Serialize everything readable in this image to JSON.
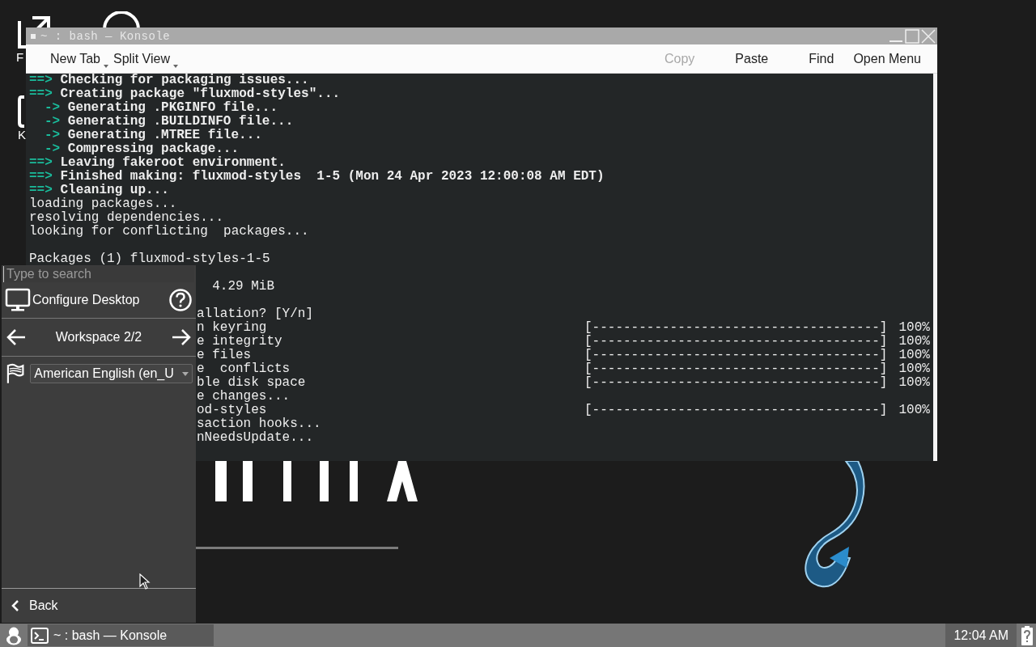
{
  "desktop": {
    "icons": [
      {
        "label": "F"
      },
      {
        "label": "K"
      }
    ]
  },
  "konsole": {
    "title": "~ : bash — Konsole",
    "toolbar": [
      {
        "label": "New Tab",
        "kind": "menu",
        "disabled": false
      },
      {
        "label": "Split View",
        "kind": "menu",
        "disabled": false
      },
      {
        "label": "Copy",
        "kind": "action",
        "disabled": true
      },
      {
        "label": "Paste",
        "kind": "action",
        "disabled": false
      },
      {
        "label": "Find",
        "kind": "action",
        "disabled": false
      },
      {
        "label": "Open Menu",
        "kind": "action",
        "disabled": false
      }
    ],
    "lines": [
      {
        "kind": "step",
        "marker": "==>",
        "text": "Checking for packaging issues..."
      },
      {
        "kind": "step",
        "marker": "==>",
        "text": "Creating package \"fluxmod-styles\"..."
      },
      {
        "kind": "substep",
        "marker": "->",
        "text": "Generating .PKGINFO file..."
      },
      {
        "kind": "substep",
        "marker": "->",
        "text": "Generating .BUILDINFO file..."
      },
      {
        "kind": "substep",
        "marker": "->",
        "text": "Generating .MTREE file..."
      },
      {
        "kind": "substep",
        "marker": "->",
        "text": "Compressing package..."
      },
      {
        "kind": "step",
        "marker": "==>",
        "text": "Leaving fakeroot environment."
      },
      {
        "kind": "step",
        "marker": "==>",
        "text": "Finished making: fluxmod-styles  1-5 (Mon 24 Apr 2023 12:00:08 AM EDT)"
      },
      {
        "kind": "step",
        "marker": "==>",
        "text": "Cleaning up..."
      },
      {
        "kind": "plain",
        "text": "loading packages..."
      },
      {
        "kind": "plain",
        "text": "resolving dependencies..."
      },
      {
        "kind": "plain",
        "text": "looking for conflicting  packages..."
      },
      {
        "kind": "blank"
      },
      {
        "kind": "plain",
        "text": "Packages (1) fluxmod-styles-1-5"
      },
      {
        "kind": "blank"
      },
      {
        "kind": "clipped",
        "text": "  4.29 MiB"
      },
      {
        "kind": "blank"
      },
      {
        "kind": "clipped",
        "text": "allation? [Y/n]"
      },
      {
        "kind": "clipped",
        "text": "n keyring",
        "bar": "[-------------------------------------]",
        "percent": "100%"
      },
      {
        "kind": "clipped",
        "text": "e integrity",
        "bar": "[-------------------------------------]",
        "percent": "100%"
      },
      {
        "kind": "clipped",
        "text": "e files",
        "bar": "[-------------------------------------]",
        "percent": "100%"
      },
      {
        "kind": "clipped",
        "text": "e  conflicts",
        "bar": "[-------------------------------------]",
        "percent": "100%"
      },
      {
        "kind": "clipped",
        "text": "ble disk space",
        "bar": "[-------------------------------------]",
        "percent": "100%"
      },
      {
        "kind": "clipped",
        "text": "e changes..."
      },
      {
        "kind": "clipped",
        "text": "od-styles",
        "bar": "[-------------------------------------]",
        "percent": "100%"
      },
      {
        "kind": "clipped",
        "text": "saction hooks..."
      },
      {
        "kind": "clipped",
        "text": "nNeedsUpdate..."
      }
    ]
  },
  "menu": {
    "search": {
      "placeholder": "Type to search"
    },
    "configure": "Configure Desktop",
    "workspace": "Workspace 2/2",
    "language": "American English (en_U",
    "back": "Back"
  },
  "taskbar": {
    "tasks": [
      {
        "label": "~ : bash — Konsole",
        "selected": true
      }
    ],
    "clock": "12:04 AM"
  }
}
